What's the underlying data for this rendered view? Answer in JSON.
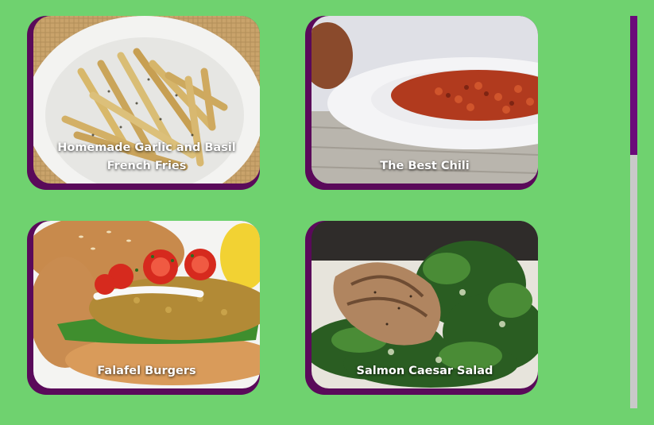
{
  "recipes": [
    {
      "title": "Homemade Garlic and Basil French Fries",
      "image_alt": "garlic basil fries on a white plate"
    },
    {
      "title": "The Best Chili",
      "image_alt": "bowl of red chili"
    },
    {
      "title": "Falafel Burgers",
      "image_alt": "falafel burger with tomatoes and spinach"
    },
    {
      "title": "Salmon Caesar Salad",
      "image_alt": "salmon fillet on caesar salad"
    }
  ],
  "colors": {
    "page_background": "#6fd26f",
    "card_accent": "#5a0a5a",
    "scroll_thumb": "#6b0a7a",
    "scroll_track": "#c9c9c9",
    "title_text": "#ffffff"
  },
  "scrollbar": {
    "thumb_fraction": 0.35,
    "position_fraction": 0.0
  }
}
